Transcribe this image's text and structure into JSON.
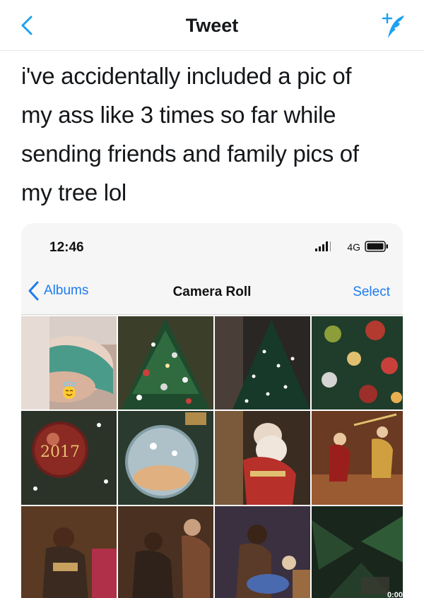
{
  "header": {
    "title": "Tweet",
    "back_icon": "chevron-left-icon",
    "compose_icon": "compose-tweet-icon",
    "accent_color": "#1da1f2"
  },
  "tweet": {
    "lines": [
      "i've accidentally included a pic of",
      "my ass like 3 times so far while",
      "sending friends and family pics of",
      "my tree lol"
    ]
  },
  "screenshot": {
    "status_bar": {
      "time": "12:46",
      "network": "4G",
      "signal_icon": "signal-bars-icon",
      "battery_icon": "battery-icon"
    },
    "nav": {
      "back_label": "Albums",
      "title": "Camera Roll",
      "select_label": "Select",
      "link_color": "#1d7bf0"
    },
    "photos": [
      {
        "subject": "body photo",
        "emoji": "smiling-face-with-halo-icon"
      },
      {
        "subject": "christmas tree"
      },
      {
        "subject": "christmas tree"
      },
      {
        "subject": "tree ornaments"
      },
      {
        "subject": "2017 ornament",
        "ornament_text": "2017"
      },
      {
        "subject": "glass ornament"
      },
      {
        "subject": "santa figurine"
      },
      {
        "subject": "angel figurines"
      },
      {
        "subject": "nativity figure"
      },
      {
        "subject": "nativity figure"
      },
      {
        "subject": "nativity scene"
      },
      {
        "subject": "tree close-up",
        "duration": "0:00"
      }
    ]
  }
}
